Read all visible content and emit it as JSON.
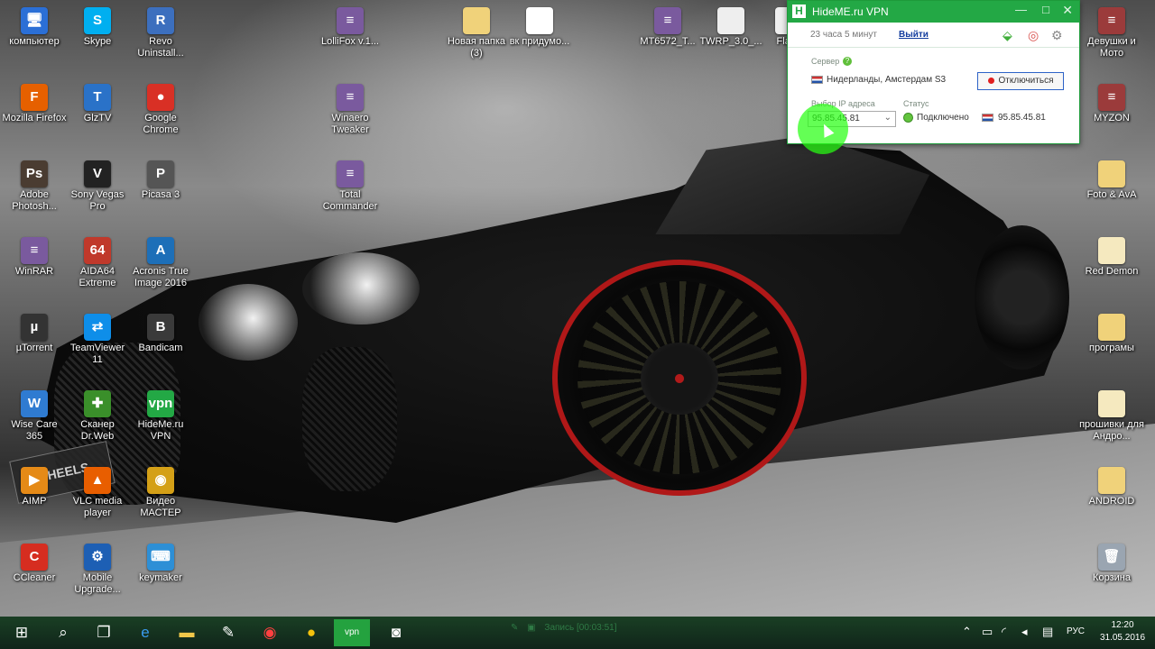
{
  "desktop": {
    "icons_left": [
      {
        "label": "компьютер",
        "icon": "computer-icon",
        "glyph": "🖥",
        "color": "#2b6fd6"
      },
      {
        "label": "Skype",
        "icon": "skype-icon",
        "glyph": "S",
        "color": "#00aff0"
      },
      {
        "label": "Revo Uninstall...",
        "icon": "revo-uninstaller-icon",
        "glyph": "R",
        "color": "#3c6fbe"
      },
      {
        "label": "Mozilla Firefox",
        "icon": "firefox-icon",
        "glyph": "F",
        "color": "#e66000"
      },
      {
        "label": "GlzTV",
        "icon": "tv-icon",
        "glyph": "T",
        "color": "#2a72c8"
      },
      {
        "label": "Google Chrome",
        "icon": "chrome-icon",
        "glyph": "●",
        "color": "#d93025"
      },
      {
        "label": "Adobe Photosh...",
        "icon": "photoshop-icon",
        "glyph": "Ps",
        "color": "#4a3c31"
      },
      {
        "label": "Sony Vegas Pro",
        "icon": "sony-vegas-icon",
        "glyph": "V",
        "color": "#222222"
      },
      {
        "label": "Picasa 3",
        "icon": "picasa-icon",
        "glyph": "P",
        "color": "#555555"
      },
      {
        "label": "WinRAR",
        "icon": "winrar-icon",
        "glyph": "≡",
        "color": "#7a5a9e"
      },
      {
        "label": "AIDA64 Extreme",
        "icon": "aida64-icon",
        "glyph": "64",
        "color": "#c0392b"
      },
      {
        "label": "Acronis True Image 2016",
        "icon": "acronis-icon",
        "glyph": "A",
        "color": "#1d6fb8"
      },
      {
        "label": "µTorrent",
        "icon": "utorrent-icon",
        "glyph": "µ",
        "color": "#333333"
      },
      {
        "label": "TeamViewer 11",
        "icon": "teamviewer-icon",
        "glyph": "⇄",
        "color": "#0e8ee9"
      },
      {
        "label": "Bandicam",
        "icon": "bandicam-icon",
        "glyph": "B",
        "color": "#3a3a3a"
      },
      {
        "label": "Wise Care 365",
        "icon": "wise-care-icon",
        "glyph": "W",
        "color": "#2f7bd1"
      },
      {
        "label": "Сканер Dr.Web",
        "icon": "drweb-scanner-icon",
        "glyph": "✚",
        "color": "#3a8f2a"
      },
      {
        "label": "HideMe.ru VPN",
        "icon": "hideme-vpn-icon",
        "glyph": "vpn",
        "color": "#23a845"
      },
      {
        "label": "AIMP",
        "icon": "aimp-icon",
        "glyph": "▶",
        "color": "#e58a17"
      },
      {
        "label": "VLC media player",
        "icon": "vlc-icon",
        "glyph": "▲",
        "color": "#e85e00"
      },
      {
        "label": "Видео МАСТЕР",
        "icon": "video-master-icon",
        "glyph": "◉",
        "color": "#d4a017"
      },
      {
        "label": "CCleaner",
        "icon": "ccleaner-icon",
        "glyph": "C",
        "color": "#d62d20"
      },
      {
        "label": "Mobile Upgrade...",
        "icon": "mobile-upgrade-icon",
        "glyph": "⚙",
        "color": "#1d5fb4"
      },
      {
        "label": "keymaker",
        "icon": "keymaker-icon",
        "glyph": "⌨",
        "color": "#2d8fd6"
      }
    ],
    "icons_top": [
      {
        "label": "LolliFox v.1...",
        "icon": "archive-icon",
        "glyph": "≡",
        "color": "#7a5a9e"
      },
      {
        "label": "Новая папка (3)",
        "icon": "folder-icon",
        "glyph": "",
        "color": "#f0d27a"
      },
      {
        "label": "вк придумо...",
        "icon": "document-icon",
        "glyph": "",
        "color": "#ffffff"
      },
      {
        "label": "MT6572_T...",
        "icon": "archive-icon",
        "glyph": "≡",
        "color": "#7a5a9e"
      },
      {
        "label": "TWRP_3.0_...",
        "icon": "file-icon",
        "glyph": "",
        "color": "#eeeeee"
      },
      {
        "label": "Flash",
        "icon": "file-icon",
        "glyph": "",
        "color": "#eeeeee"
      }
    ],
    "icons_mid": [
      {
        "label": "Winaero Tweaker",
        "icon": "winaero-archive-icon",
        "glyph": "≡",
        "color": "#7a5a9e"
      },
      {
        "label": "Total Commander",
        "icon": "total-commander-archive-icon",
        "glyph": "≡",
        "color": "#7a5a9e"
      }
    ],
    "icons_right": [
      {
        "label": "Девушки и Мото",
        "icon": "archive-icon",
        "glyph": "≡",
        "color": "#9b3b3b"
      },
      {
        "label": "MYZON",
        "icon": "archive-icon",
        "glyph": "≡",
        "color": "#9b3b3b"
      },
      {
        "label": "Foto & AvA",
        "icon": "folder-icon",
        "glyph": "",
        "color": "#f0d27a"
      },
      {
        "label": "Red Demon",
        "icon": "folder-icon",
        "glyph": "",
        "color": "#f5e9bf"
      },
      {
        "label": "програмы",
        "icon": "folder-icon",
        "glyph": "",
        "color": "#f0d27a"
      },
      {
        "label": "прошивки для Андро...",
        "icon": "folder-icon",
        "glyph": "",
        "color": "#f5e9bf"
      },
      {
        "label": "ANDROID",
        "icon": "folder-icon",
        "glyph": "",
        "color": "#f0d27a"
      },
      {
        "label": "Корзина",
        "icon": "recycle-bin-icon",
        "glyph": "🗑",
        "color": "#9aa5b1"
      }
    ],
    "wallpaper_plate": "WHEELS"
  },
  "vpn_window": {
    "title": "HideME.ru VPN",
    "logo_letter": "H",
    "time_left": "23 часа 5 минут",
    "logout_label": "Выйти",
    "server_label": "Сервер",
    "server_value": "Нидерланды, Амстердам S3",
    "disconnect_label": "Отключиться",
    "ip_label": "Выбор IP адреса",
    "ip_value": "95.85.45.81",
    "status_label": "Статус",
    "status_value": "Подключено",
    "external_ip": "95.85.45.81",
    "accent": "#23a845"
  },
  "taskbar": {
    "recording": "Запись [00:03:51]",
    "language": "РУС",
    "time": "12:20",
    "date": "31.05.2016"
  }
}
